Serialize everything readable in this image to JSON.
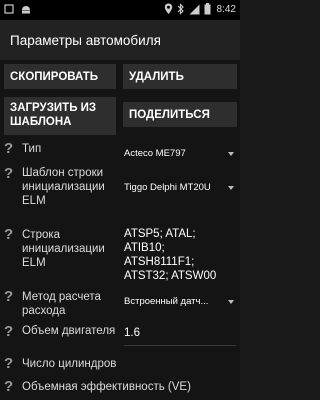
{
  "status_bar": {
    "left_icons": [
      "notification-square-icon",
      "android-debug-icon"
    ],
    "right_icons": [
      "location-icon",
      "bluetooth-icon",
      "signal-icon",
      "battery-icon"
    ],
    "time": "8:42"
  },
  "action_bar": {
    "title": "Параметры автомобиля"
  },
  "buttons": {
    "copy": "СКОПИРОВАТЬ",
    "delete": "УДАЛИТЬ",
    "load_template": "ЗАГРУЗИТЬ ИЗ ШАБЛОНА",
    "share": "ПОДЕЛИТЬСЯ"
  },
  "fields": [
    {
      "label": "Тип",
      "value": "Acteco ME797"
    },
    {
      "label": "Шаблон строки инициализации ELM",
      "value": "Tiggo Delphi MT20U"
    },
    {
      "label": "Строка инициализации ELM",
      "value": "ATSP5; ATAL; ATIB10; ATSH8111F1; ATST32; ATSW00"
    },
    {
      "label": "Метод расчета расхода",
      "value": "Встроенный датч..."
    },
    {
      "label": "Объем двигателя",
      "value": "1.6"
    },
    {
      "label": "Число цилиндров",
      "value": ""
    },
    {
      "label": "Объемная эффективность (VE)",
      "value": ""
    }
  ],
  "colors": {
    "background": "#141414",
    "button": "#2e2e2e",
    "action_bar": "#222222"
  }
}
